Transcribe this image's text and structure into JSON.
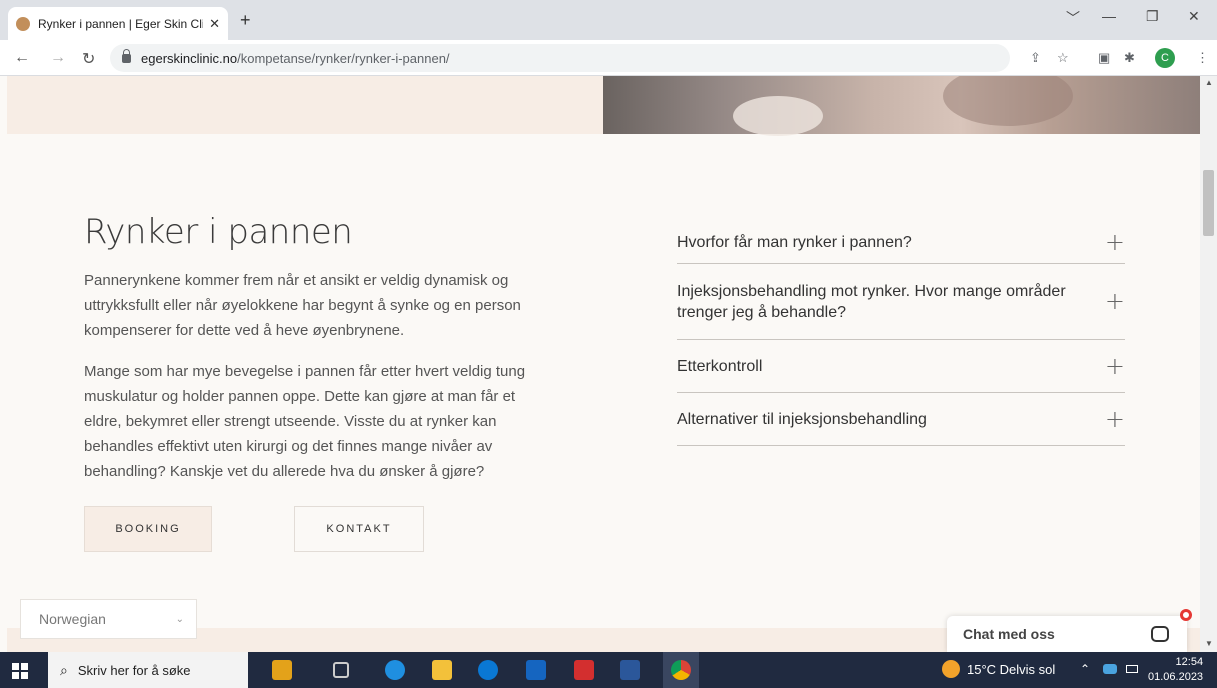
{
  "browser": {
    "tab_title": "Rynker i pannen | Eger Skin Clinic",
    "tab_close": "✕",
    "new_tab": "+",
    "url_host": "egerskinclinic.no",
    "url_path": "/kompetanse/rynker/rynker-i-pannen/",
    "profile_initial": "C",
    "controls": [
      "﹀",
      "—",
      "❐",
      "✕"
    ]
  },
  "page": {
    "heading": "Rynker i pannen",
    "paragraph_1": "Pannerynkene kommer frem når et ansikt er veldig dynamisk og uttrykksfullt eller når øyelokkene har begynt å synke og en person kompenserer for dette ved å heve øyenbrynene.",
    "paragraph_2": "Mange som har mye bevegelse i pannen får etter hvert veldig tung muskulatur og holder pannen oppe. Dette kan gjøre at man får et eldre, bekymret eller strengt utseende. Visste du at rynker kan behandles effektivt uten kirurgi og det finnes mange nivåer av behandling? Kanskje vet du allerede hva du ønsker å gjøre?",
    "booking_label": "BOOKING",
    "contact_label": "KONTAKT",
    "faq": [
      {
        "question": "Hvorfor får man rynker i pannen?"
      },
      {
        "question": "Injeksjonsbehandling mot rynker. Hvor mange områder trenger jeg å behandle?"
      },
      {
        "question": "Etterkontroll"
      },
      {
        "question": "Alternativer til injeksjonsbehandling"
      }
    ],
    "faq_expand_symbol": "+",
    "language_selected": "Norwegian",
    "chat_label": "Chat med oss"
  },
  "taskbar": {
    "search_placeholder": "Skriv her for å søke",
    "weather": "15°C  Delvis sol",
    "time": "12:54",
    "date": "01.06.2023"
  },
  "colors": {
    "accent_band": "#f7ede5",
    "page_bg": "#fbf9f6",
    "taskbar": "#202a40"
  }
}
